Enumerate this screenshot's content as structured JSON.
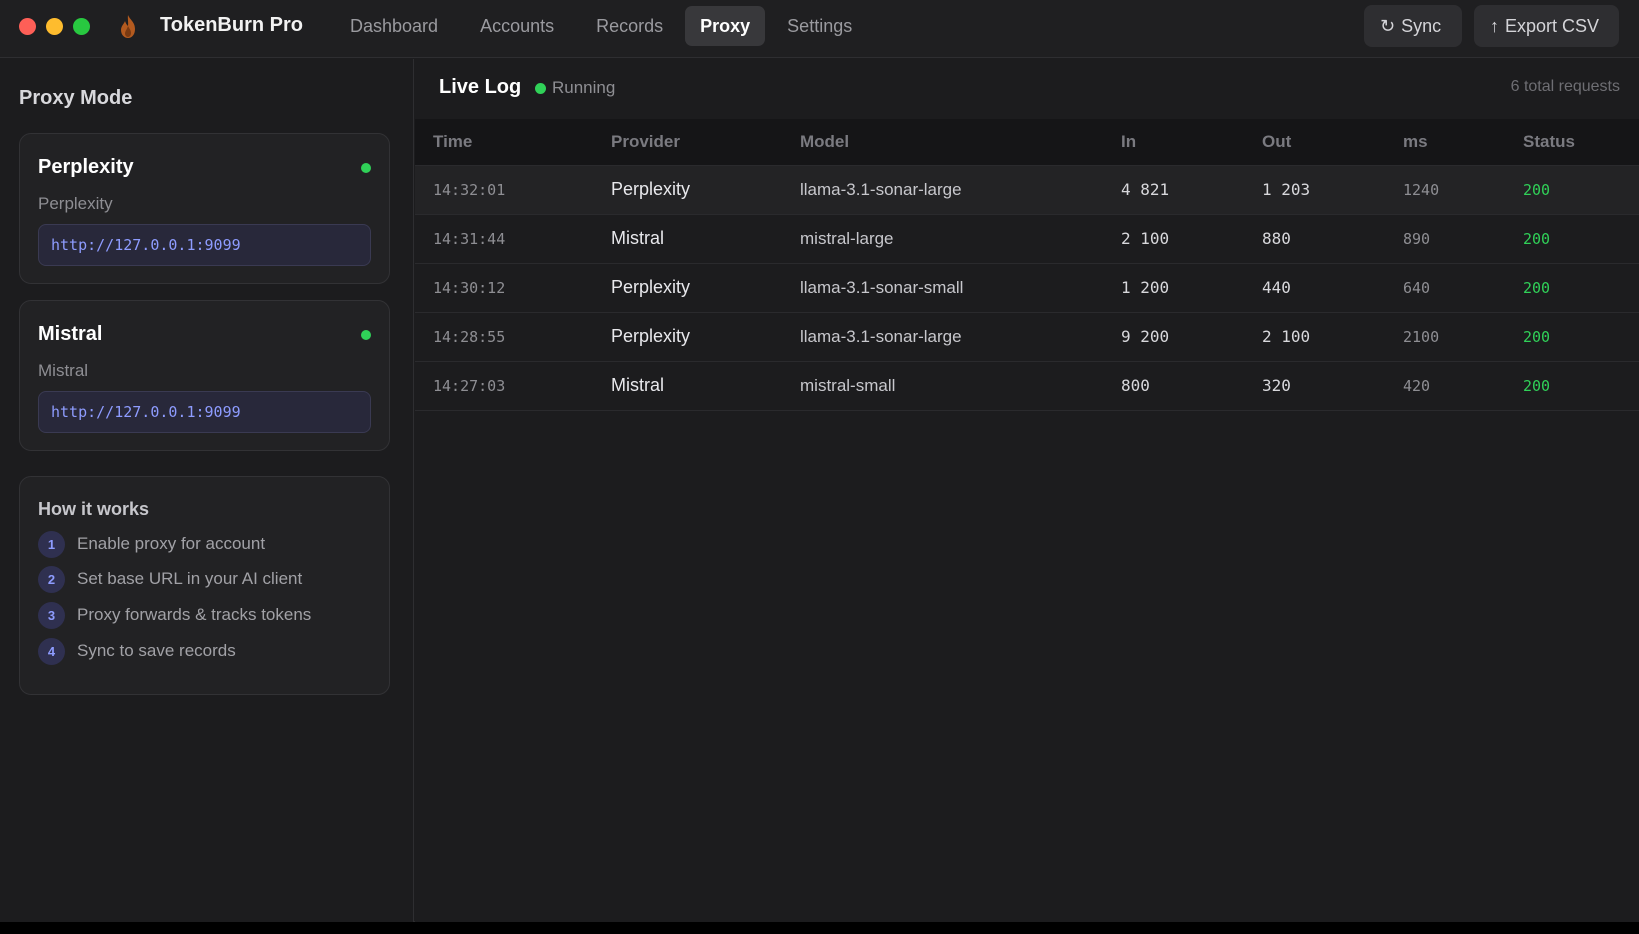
{
  "app": {
    "title": "TokenBurn Pro"
  },
  "nav": {
    "tabs": [
      {
        "label": "Dashboard",
        "active": false
      },
      {
        "label": "Accounts",
        "active": false
      },
      {
        "label": "Records",
        "active": false
      },
      {
        "label": "Proxy",
        "active": true
      },
      {
        "label": "Settings",
        "active": false
      }
    ]
  },
  "toolbar": {
    "sync_icon": "↻",
    "sync_label": "Sync",
    "export_icon": "↑",
    "export_label": "Export CSV"
  },
  "sidebar": {
    "title": "Proxy Mode",
    "proxies": [
      {
        "name": "Perplexity",
        "subtitle": "Perplexity",
        "url": "http://127.0.0.1:9099",
        "status_color": "#30d158"
      },
      {
        "name": "Mistral",
        "subtitle": "Mistral",
        "url": "http://127.0.0.1:9099",
        "status_color": "#30d158"
      }
    ],
    "how_it_works": {
      "title": "How it works",
      "steps": [
        {
          "num": "1",
          "text": "Enable proxy for account"
        },
        {
          "num": "2",
          "text": "Set base URL in your AI client"
        },
        {
          "num": "3",
          "text": "Proxy forwards & tracks tokens"
        },
        {
          "num": "4",
          "text": "Sync to save records"
        }
      ]
    }
  },
  "log": {
    "title": "Live Log",
    "status": "Running",
    "total": "6 total requests",
    "columns": [
      "Time",
      "Provider",
      "Model",
      "In",
      "Out",
      "ms",
      "Status"
    ],
    "rows": [
      [
        "14:32:01",
        "Perplexity",
        "llama-3.1-sonar-large",
        "4 821",
        "1 203",
        "1240",
        "200"
      ],
      [
        "14:31:44",
        "Mistral",
        "mistral-large",
        "2 100",
        "880",
        "890",
        "200"
      ],
      [
        "14:30:12",
        "Perplexity",
        "llama-3.1-sonar-small",
        "1 200",
        "440",
        "640",
        "200"
      ],
      [
        "14:28:55",
        "Perplexity",
        "llama-3.1-sonar-large",
        "9 200",
        "2 100",
        "2100",
        "200"
      ],
      [
        "14:27:03",
        "Mistral",
        "mistral-small",
        "800",
        "320",
        "420",
        "200"
      ]
    ]
  },
  "colors": {
    "accent": "#8e9cff",
    "success": "#30d158",
    "active_tab_bg": "#38383b"
  }
}
